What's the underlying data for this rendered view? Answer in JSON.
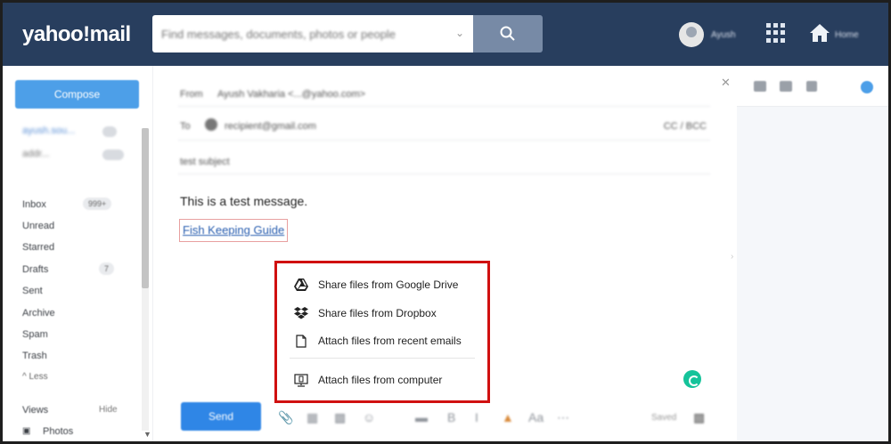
{
  "header": {
    "logo": "yahoo!mail",
    "search_placeholder": "Find messages, documents, photos or people",
    "user_name": "Ayush",
    "home_label": "Home"
  },
  "sidebar": {
    "compose_label": "Compose",
    "accounts": [
      {
        "label": "ayush.sou..."
      },
      {
        "label": "addr..."
      }
    ],
    "folders": [
      {
        "label": "Inbox",
        "count": "999+"
      },
      {
        "label": "Unread",
        "count": ""
      },
      {
        "label": "Starred",
        "count": ""
      },
      {
        "label": "Drafts",
        "count": "7"
      },
      {
        "label": "Sent",
        "count": ""
      },
      {
        "label": "Archive",
        "count": ""
      },
      {
        "label": "Spam",
        "count": ""
      },
      {
        "label": "Trash",
        "count": ""
      }
    ],
    "less_label": "^ Less",
    "views_label": "Views",
    "hide_label": "Hide",
    "photos_label": "Photos"
  },
  "compose": {
    "from_label": "From",
    "from_value": "Ayush Vakharia <...@yahoo.com>",
    "to_label": "To",
    "to_value": "recipient@gmail.com",
    "cc_label": "CC / BCC",
    "subject": "test subject",
    "body_text": "This is a test message.",
    "link_text": "Fish Keeping Guide",
    "send_label": "Send",
    "saved_label": "Saved"
  },
  "attach_menu": {
    "items": [
      {
        "label": "Share files from Google Drive",
        "icon": "google-drive-icon"
      },
      {
        "label": "Share files from Dropbox",
        "icon": "dropbox-icon"
      },
      {
        "label": "Attach files from recent emails",
        "icon": "document-icon"
      },
      {
        "label": "Attach files from computer",
        "icon": "computer-icon"
      }
    ]
  },
  "colors": {
    "header_bg": "#283e5e",
    "accent": "#2f86e6",
    "highlight_border": "#d01010"
  }
}
